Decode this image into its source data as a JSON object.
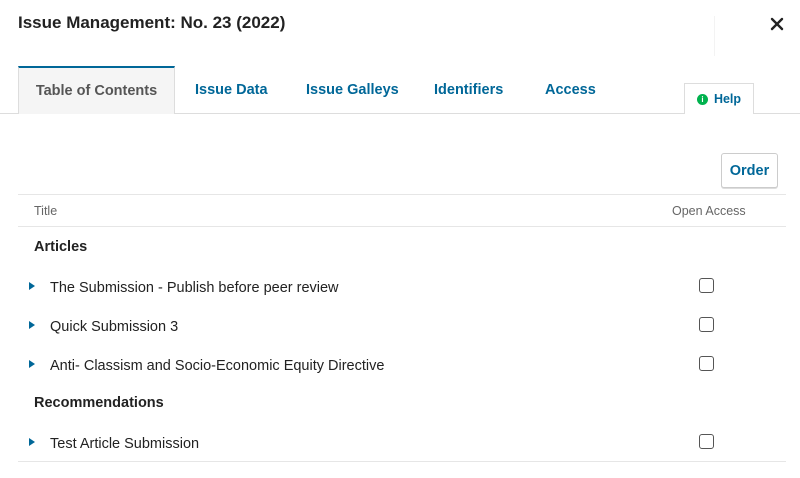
{
  "modal": {
    "title": "Issue Management: No. 23 (2022)",
    "close_icon": "close-icon"
  },
  "tabs": [
    {
      "label": "Table of Contents",
      "active": true
    },
    {
      "label": "Issue Data",
      "active": false
    },
    {
      "label": "Issue Galleys",
      "active": false
    },
    {
      "label": "Identifiers",
      "active": false
    },
    {
      "label": "Access",
      "active": false
    }
  ],
  "help": {
    "label": "Help",
    "icon": "info-icon",
    "icon_color": "#00b24e"
  },
  "toolbar": {
    "order_label": "Order"
  },
  "table": {
    "columns": {
      "title": "Title",
      "open_access": "Open Access"
    },
    "sections": [
      {
        "label": "Articles",
        "rows": [
          {
            "title": "The Submission - Publish before peer review",
            "open_access": false
          },
          {
            "title": "Quick Submission 3",
            "open_access": false
          },
          {
            "title": "Anti- Classism and Socio-Economic Equity Directive",
            "open_access": false
          }
        ]
      },
      {
        "label": "Recommendations",
        "rows": [
          {
            "title": "Test Article Submission",
            "open_access": false
          }
        ]
      }
    ]
  },
  "colors": {
    "accent": "#006798",
    "text": "#222222",
    "border": "#dddddd"
  }
}
